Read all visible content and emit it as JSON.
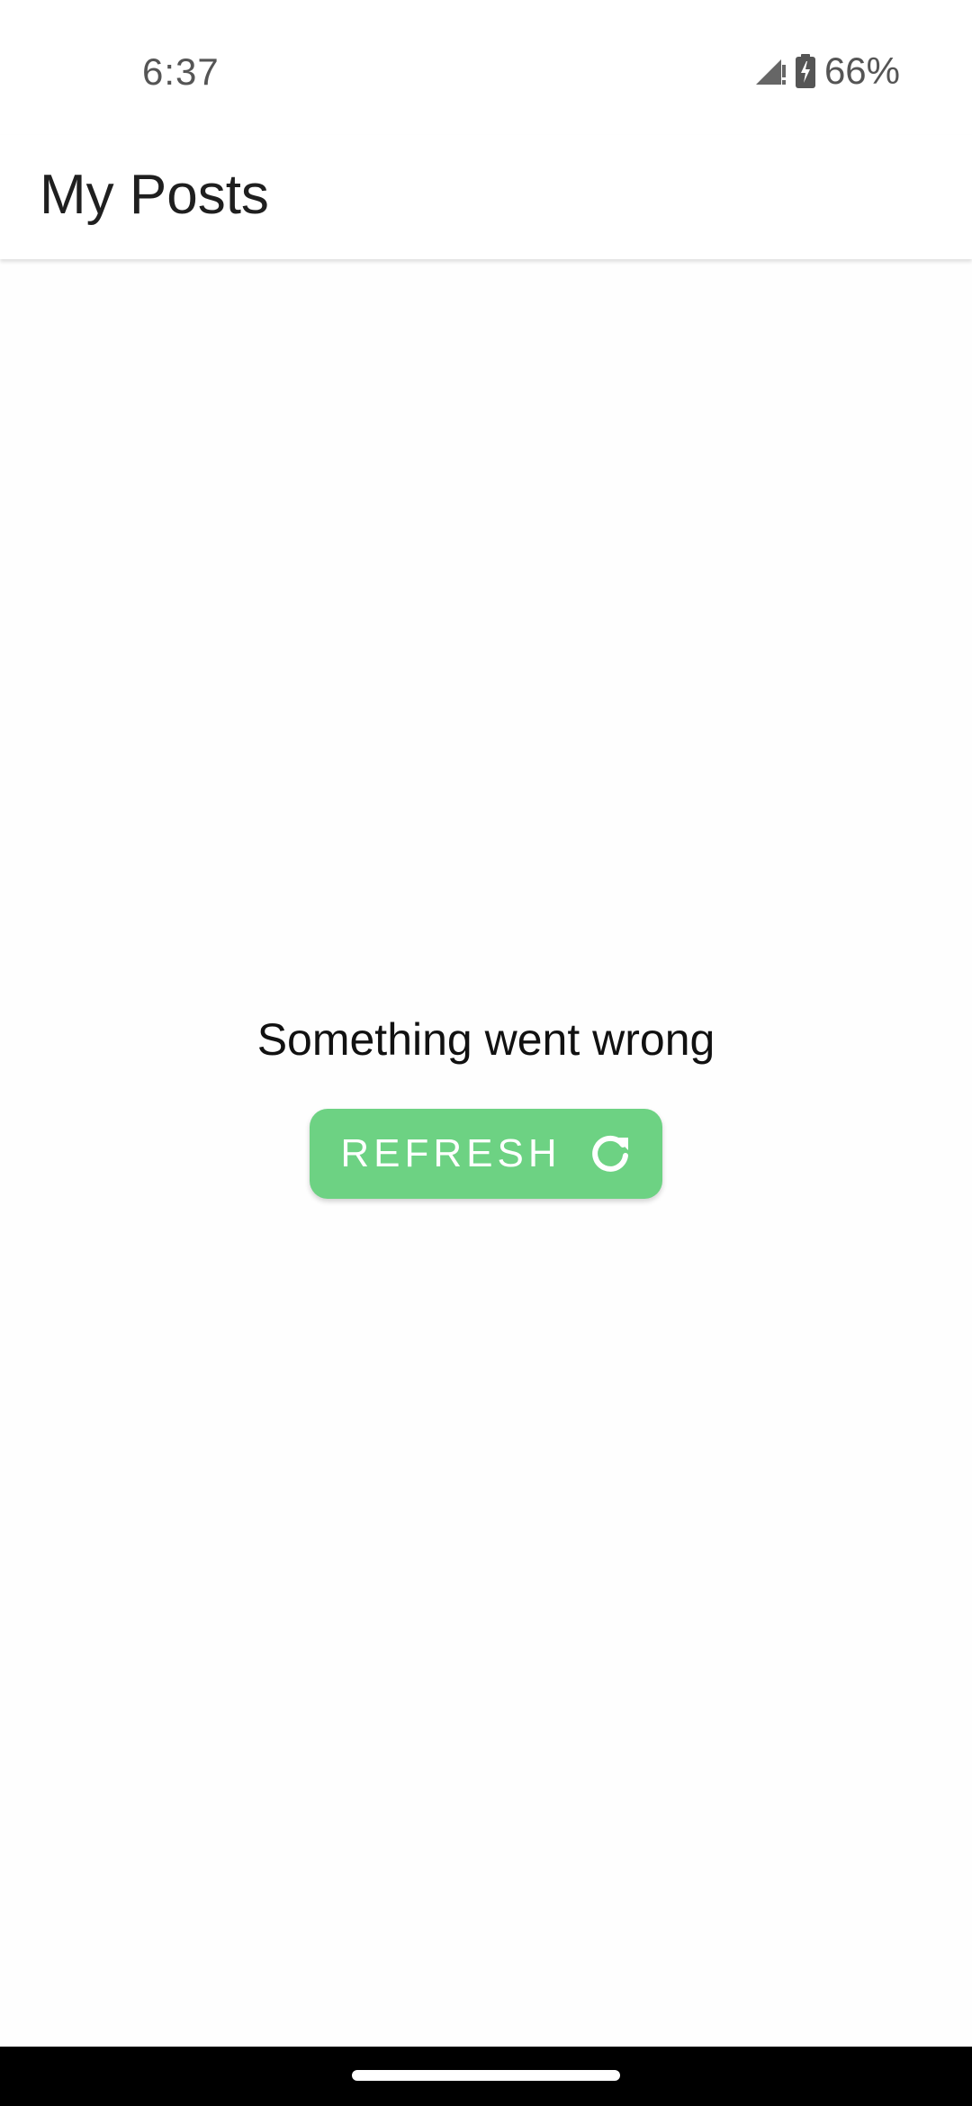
{
  "status_bar": {
    "time": "6:37",
    "battery_percent": "66%",
    "icons": [
      "signal-no-service-icon",
      "battery-charging-icon"
    ]
  },
  "app_bar": {
    "title": "My Posts"
  },
  "content": {
    "error_message": "Something went wrong",
    "refresh_button": {
      "label": "REFRESH",
      "icon": "refresh-icon"
    }
  },
  "colors": {
    "button_green": "#6dd283",
    "text_dark": "#1f1f1f",
    "background": "#fefefe",
    "status_gray": "#555555"
  }
}
